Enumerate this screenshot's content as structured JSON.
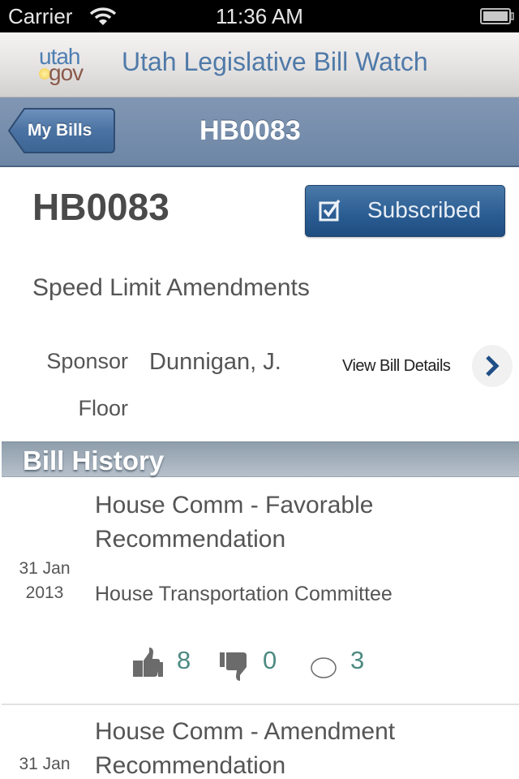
{
  "status_bar": {
    "carrier": "Carrier",
    "time": "11:36 AM"
  },
  "brand": {
    "logo_top": "utah",
    "logo_bottom": "gov",
    "title": "Utah Legislative Bill Watch"
  },
  "nav": {
    "back_label": "My Bills",
    "title": "HB0083"
  },
  "bill": {
    "id": "HB0083",
    "subscribe_label": "Subscribed",
    "description": "Speed Limit Amendments",
    "sponsor_label": "Sponsor",
    "sponsor_value": "Dunnigan, J.",
    "floor_label": "Floor",
    "details_link": "View Bill Details"
  },
  "history": {
    "header": "Bill History",
    "items": [
      {
        "date_day": "31 Jan",
        "date_year": "2013",
        "action_line1": "House Comm - Favorable",
        "action_line2": "Recommendation",
        "committee": "House Transportation Committee",
        "votes": {
          "yes": "8",
          "no": "0",
          "absent": "3"
        }
      },
      {
        "date_day": "31 Jan",
        "action_line1": "House Comm - Amendment",
        "action_line2": "Recommendation"
      }
    ]
  },
  "colors": {
    "accent_blue": "#2a5c92",
    "nav_blue": "#7890ae",
    "vote_teal": "#4d8a82"
  }
}
